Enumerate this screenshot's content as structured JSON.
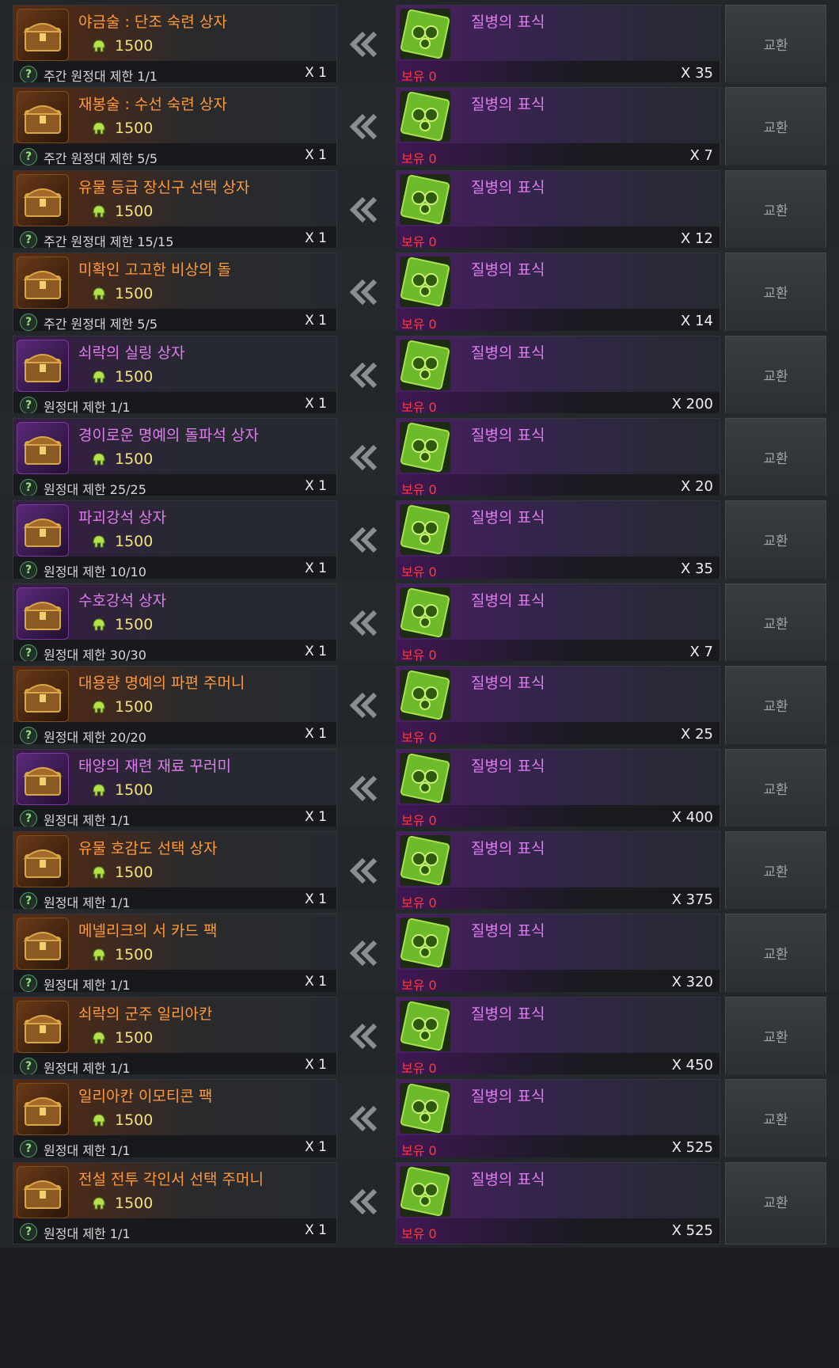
{
  "colors": {
    "legendary_name": "#ff9a3c",
    "epic_name": "#e07cf0",
    "price": "#f2e27a",
    "owned_zero": "#ff3a3a"
  },
  "icons": {
    "price": "helmet-icon",
    "transfer": "double-chevron-left-icon",
    "help": "question-icon"
  },
  "exchange_label": "교환",
  "rows": [
    {
      "name": "야금술 : 단조 숙련 상자",
      "grade": "orange",
      "icon": "red-chest-icon",
      "price": "1500",
      "limit": "주간 원정대 제한 1/1",
      "qty": "X 1",
      "cost_name": "질병의 표식",
      "owned": "보유 0",
      "cost_qty": "X 35"
    },
    {
      "name": "재봉술 : 수선 숙련 상자",
      "grade": "orange",
      "icon": "silver-chest-icon",
      "price": "1500",
      "limit": "주간 원정대 제한 5/5",
      "qty": "X 1",
      "cost_name": "질병의 표식",
      "owned": "보유 0",
      "cost_qty": "X 7"
    },
    {
      "name": "유물 등급 장신구 선택 상자",
      "grade": "orange",
      "icon": "steel-chest-icon",
      "price": "1500",
      "limit": "주간 원정대 제한 15/15",
      "qty": "X 1",
      "cost_name": "질병의 표식",
      "owned": "보유 0",
      "cost_qty": "X 12"
    },
    {
      "name": "미확인 고고한 비상의 돌",
      "grade": "orange",
      "icon": "unknown-stone-icon",
      "price": "1500",
      "limit": "주간 원정대 제한 5/5",
      "qty": "X 1",
      "cost_name": "질병의 표식",
      "owned": "보유 0",
      "cost_qty": "X 14"
    },
    {
      "name": "쇠락의 실링 상자",
      "grade": "purple",
      "icon": "silling-chest-icon",
      "price": "1500",
      "limit": "원정대 제한 1/1",
      "qty": "X 1",
      "cost_name": "질병의 표식",
      "owned": "보유 0",
      "cost_qty": "X 200"
    },
    {
      "name": "경이로운 명예의 돌파석 상자",
      "grade": "purple",
      "icon": "gold-chest-icon",
      "price": "1500",
      "limit": "원정대 제한 25/25",
      "qty": "X 1",
      "cost_name": "질병의 표식",
      "owned": "보유 0",
      "cost_qty": "X 20"
    },
    {
      "name": "파괴강석 상자",
      "grade": "purple",
      "icon": "red-chest-icon",
      "price": "1500",
      "limit": "원정대 제한 10/10",
      "qty": "X 1",
      "cost_name": "질병의 표식",
      "owned": "보유 0",
      "cost_qty": "X 35"
    },
    {
      "name": "수호강석 상자",
      "grade": "purple",
      "icon": "blue-chest-icon",
      "price": "1500",
      "limit": "원정대 제한 30/30",
      "qty": "X 1",
      "cost_name": "질병의 표식",
      "owned": "보유 0",
      "cost_qty": "X 7"
    },
    {
      "name": "대용량 명예의 파편 주머니",
      "grade": "orange",
      "icon": "pouch-icon",
      "price": "1500",
      "limit": "원정대 제한 20/20",
      "qty": "X 1",
      "cost_name": "질병의 표식",
      "owned": "보유 0",
      "cost_qty": "X 25"
    },
    {
      "name": "태양의 재련 재료 꾸러미",
      "grade": "purple",
      "icon": "red-bag-icon",
      "price": "1500",
      "limit": "원정대 제한 1/1",
      "qty": "X 1",
      "cost_name": "질병의 표식",
      "owned": "보유 0",
      "cost_qty": "X 400"
    },
    {
      "name": "유물 호감도 선택 상자",
      "grade": "orange",
      "icon": "gem-chest-icon",
      "price": "1500",
      "limit": "원정대 제한 1/1",
      "qty": "X 1",
      "cost_name": "질병의 표식",
      "owned": "보유 0",
      "cost_qty": "X 375"
    },
    {
      "name": "메넬리크의 서 카드 팩",
      "grade": "orange",
      "icon": "card-pack-icon",
      "price": "1500",
      "limit": "원정대 제한 1/1",
      "qty": "X 1",
      "cost_name": "질병의 표식",
      "owned": "보유 0",
      "cost_qty": "X 320"
    },
    {
      "name": "쇠락의 군주 일리아칸",
      "grade": "orange",
      "icon": "illiakan-card-icon",
      "price": "1500",
      "limit": "원정대 제한 1/1",
      "qty": "X 1",
      "cost_name": "질병의 표식",
      "owned": "보유 0",
      "cost_qty": "X 450"
    },
    {
      "name": "일리아칸 이모티콘 팩",
      "grade": "orange",
      "icon": "emoticon-pack-icon",
      "price": "1500",
      "limit": "원정대 제한 1/1",
      "qty": "X 1",
      "cost_name": "질병의 표식",
      "owned": "보유 0",
      "cost_qty": "X 525"
    },
    {
      "name": "전설 전투 각인서 선택 주머니",
      "grade": "orange",
      "icon": "satchel-icon",
      "price": "1500",
      "limit": "원정대 제한 1/1",
      "qty": "X 1",
      "cost_name": "질병의 표식",
      "owned": "보유 0",
      "cost_qty": "X 525"
    }
  ]
}
